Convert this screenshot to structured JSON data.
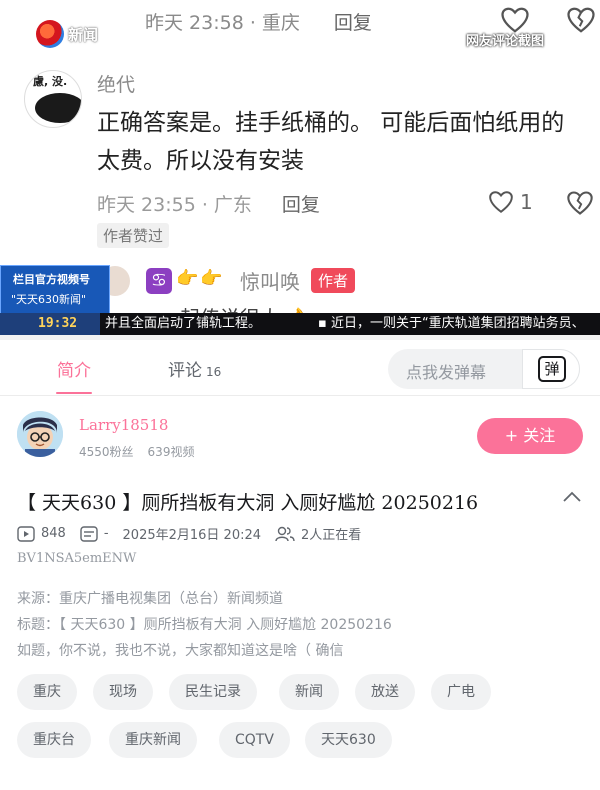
{
  "video": {
    "logo_text": "新闻",
    "screenshot_label": "网友评论截图",
    "top_meta": "昨天 23:58 · 重庆",
    "top_reply": "回复",
    "comment": {
      "avatar_text": "慮, 没.",
      "username": "绝代",
      "body": "正确答案是。挂手纸桶的。 可能后面怕纸用的太费。所以没有安装",
      "time_location": "昨天 23:55 · 广东",
      "reply": "回复",
      "like_count": "1",
      "author_liked": "作者赞过"
    },
    "reply": {
      "emoji_hands": "👉👉",
      "username": "惊叫唤",
      "author_tag": "作者",
      "partial_text": "一起传说很大 👌"
    },
    "station": {
      "line1": "栏目官方视频号",
      "line2": "\"天天630新闻\""
    },
    "ticker": {
      "clock": "19:32",
      "text1": "并且全面启动了铺轨工程。",
      "text2": "▪  近日，一则关于“重庆轨道集团招聘站务员、"
    }
  },
  "tabs": {
    "intro": "简介",
    "comments": "评论",
    "comments_count": "16"
  },
  "danmaku": {
    "placeholder": "点我发弹幕",
    "button": "弹"
  },
  "uploader": {
    "name": "Larry18518",
    "fans": "4550粉丝",
    "videos": "639视频",
    "follow": "+ 关注"
  },
  "info": {
    "title": "【 天天630 】厕所挡板有大洞 入厕好尴尬 20250216",
    "plays": "848",
    "danmaku_count": "-",
    "date": "2025年2月16日  20:24",
    "watching": "2人正在看",
    "bvid": "BV1NSA5emENW",
    "desc_source": "来源：重庆广播电视集团（总台）新闻频道",
    "desc_title": "标题：【 天天630 】厕所挡板有大洞 入厕好尴尬 20250216",
    "desc_body": "如题，你不说，我也不说，大家都知道这是啥（ 确信"
  },
  "tags": [
    "重庆",
    "现场",
    "民生记录",
    "新闻",
    "放送",
    "广电",
    "重庆台",
    "重庆新闻",
    "CQTV",
    "天天630"
  ],
  "colors": {
    "accent_pink": "#fb7299",
    "ticker_bg": "#0f0f12",
    "station_blue": "#1858b7"
  }
}
